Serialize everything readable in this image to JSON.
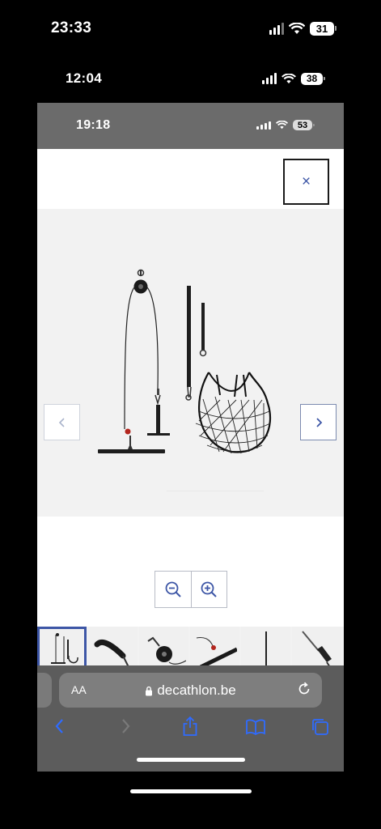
{
  "status_outer": {
    "time": "23:33",
    "battery": "31"
  },
  "status_middle": {
    "time": "12:04",
    "battery": "38"
  },
  "status_inner": {
    "time": "19:18",
    "battery": "53"
  },
  "viewer": {
    "close_label": "×"
  },
  "browser": {
    "text_size_label": "AA",
    "domain": "decathlon.be"
  },
  "icons": {
    "close": "close-icon",
    "prev": "chevron-left-icon",
    "next": "chevron-right-icon",
    "zoom_out": "zoom-out-icon",
    "zoom_in": "zoom-in-icon",
    "lock": "lock-icon",
    "reload": "reload-icon",
    "back": "back-icon",
    "forward": "forward-icon",
    "share": "share-icon",
    "bookmarks": "bookmarks-icon",
    "tabs": "tabs-icon"
  },
  "colors": {
    "accent": "#3d56a6",
    "safari_link": "#2f6bff",
    "toolbar": "#5c5c5c"
  }
}
